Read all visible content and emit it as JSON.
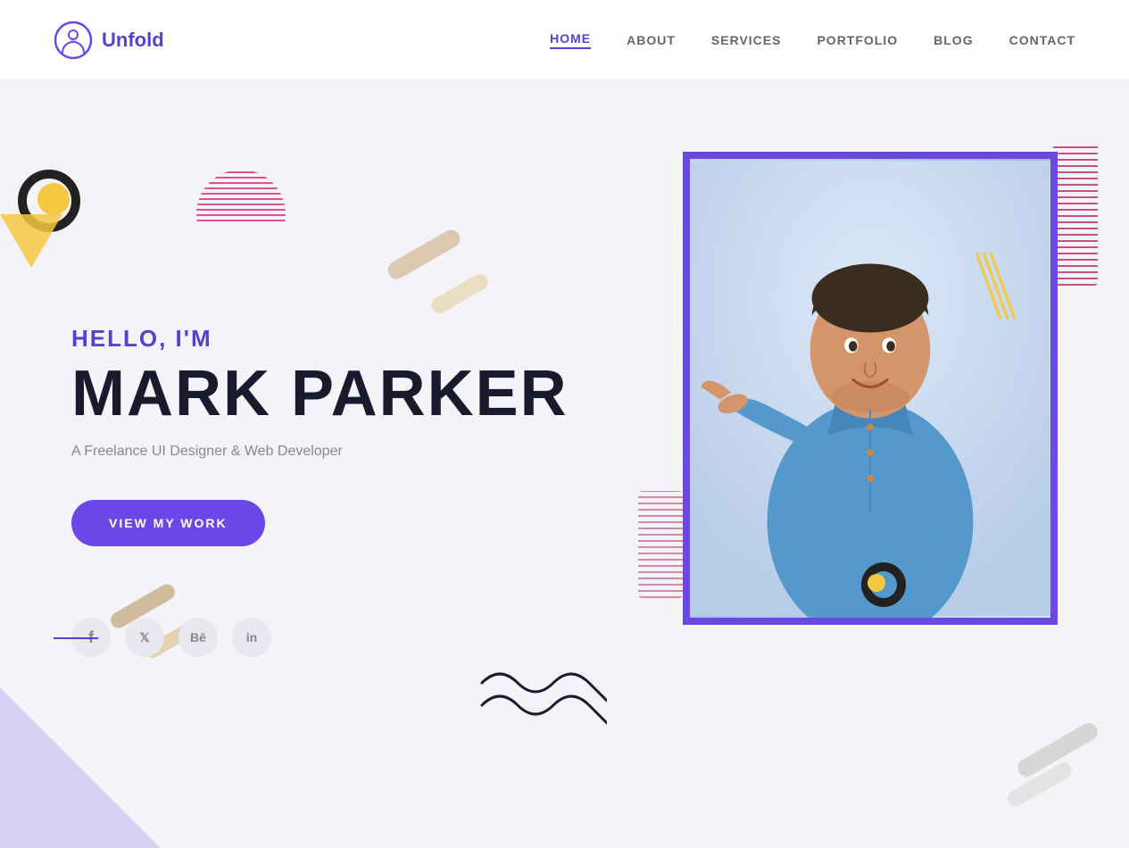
{
  "brand": {
    "name": "Unfold",
    "logo_alt": "Unfold logo"
  },
  "nav": {
    "items": [
      {
        "label": "HOME",
        "active": true,
        "id": "home"
      },
      {
        "label": "ABOUT",
        "active": false,
        "id": "about"
      },
      {
        "label": "SERVICES",
        "active": false,
        "id": "services"
      },
      {
        "label": "PORTFOLIO",
        "active": false,
        "id": "portfolio"
      },
      {
        "label": "BLOG",
        "active": false,
        "id": "blog"
      },
      {
        "label": "CONTACT",
        "active": false,
        "id": "contact"
      }
    ]
  },
  "hero": {
    "greeting": "HELLO, I'M",
    "name": "MARK PARKER",
    "subtitle": "A Freelance UI Designer & Web Developer",
    "cta_label": "VIEW MY WORK"
  },
  "social": {
    "items": [
      {
        "label": "f",
        "name": "facebook"
      },
      {
        "label": "t",
        "name": "twitter"
      },
      {
        "label": "Bē",
        "name": "behance"
      },
      {
        "label": "in",
        "name": "linkedin"
      }
    ]
  },
  "colors": {
    "accent": "#6c47e8",
    "text_dark": "#1a1a2e",
    "text_light": "#888888",
    "bg": "#f4f4f8"
  }
}
